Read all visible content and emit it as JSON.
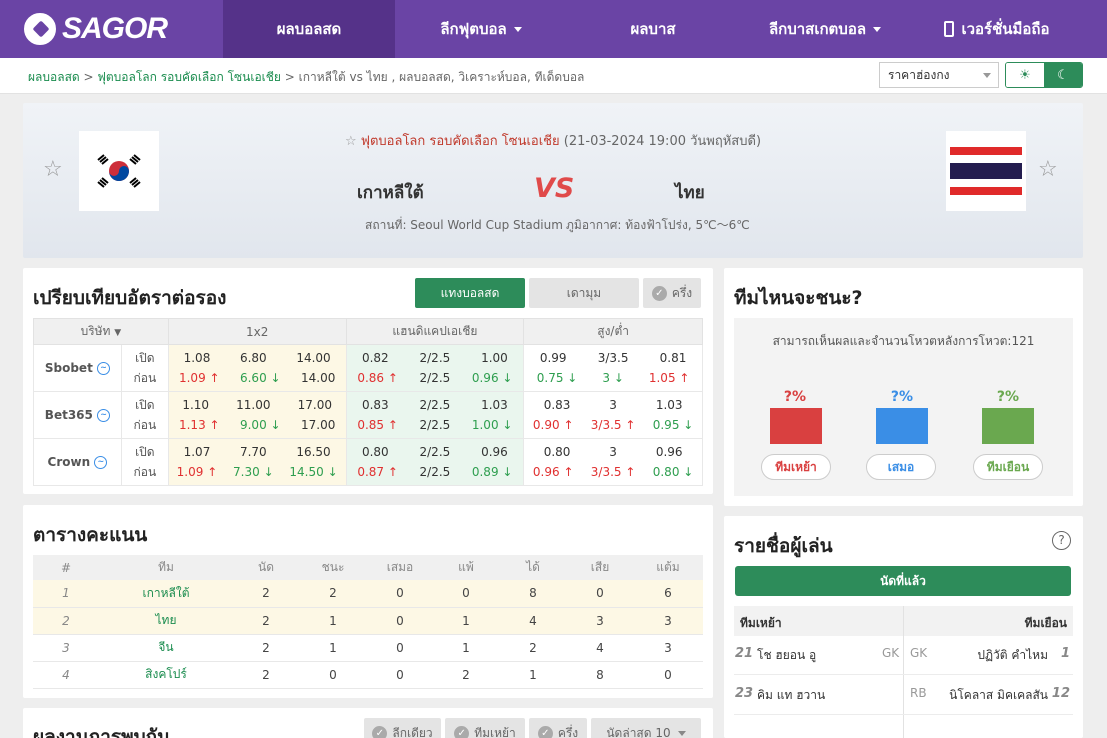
{
  "brand": {
    "name": "SAGOR"
  },
  "nav": [
    {
      "label": "ผลบอลสด",
      "active": true,
      "caret": false,
      "w": 172
    },
    {
      "label": "ลีกฟุตบอล",
      "active": false,
      "caret": true,
      "w": 172
    },
    {
      "label": "ผลบาส",
      "active": false,
      "caret": false,
      "w": 172
    },
    {
      "label": "ลีกบาสเกตบอล",
      "active": false,
      "caret": true,
      "w": 172
    },
    {
      "label": "เวอร์ชั่นมือถือ",
      "active": false,
      "caret": false,
      "w": 172
    }
  ],
  "breadcrumb": {
    "home": "ผลบอลสด",
    "league": "ฟุตบอลโลก รอบคัดเลือก โซนเอเชีย",
    "rest": "เกาหลีใต้ vs  ไทย ,  ผลบอลสด,  วิเคราะห์บอล,  ทีเด็ดบอล"
  },
  "odds_format": "ราคาฮ่องกง",
  "match": {
    "league": "ฟุตบอลโลก รอบคัดเลือก โซนเอเชีย",
    "date": "(21-03-2024 19:00 วันพฤหัสบดี)",
    "home": "เกาหลีใต้",
    "vs": "VS",
    "away": "ไทย",
    "venue": "สถานที่: Seoul World Cup Stadium",
    "weather": "ภูมิอากาศ: ท้องฟ้าโปร่ง, 5℃～6℃"
  },
  "odds_panel": {
    "title": "เปรียบเทียบอัตราต่อรอง",
    "tab_live": "แทงบอลสด",
    "tab_early": "เดามุม",
    "half": "ครึ่ง",
    "h_company": "บริษัท",
    "h_1x2": "1x2",
    "h_hdp": "แฮนดิแคปเอเชีย",
    "h_ou": "สูง/ต่ำ",
    "open": "เปิด",
    "before": "ก่อน",
    "rows": [
      {
        "company": "Sbobet",
        "o1": [
          "1.08",
          "6.80",
          "14.00"
        ],
        "c1": [
          [
            "1.09",
            "up"
          ],
          [
            "6.60",
            "dn"
          ],
          [
            "14.00",
            ""
          ]
        ],
        "o2": [
          "0.82",
          "2/2.5",
          "1.00"
        ],
        "c2": [
          [
            "0.86",
            "up"
          ],
          [
            "2/2.5",
            ""
          ],
          [
            "0.96",
            "dn"
          ]
        ],
        "o3": [
          "0.99",
          "3/3.5",
          "0.81"
        ],
        "c3": [
          [
            "0.75",
            "dn"
          ],
          [
            "3",
            "dn"
          ],
          [
            "1.05",
            "up"
          ]
        ]
      },
      {
        "company": "Bet365",
        "o1": [
          "1.10",
          "11.00",
          "17.00"
        ],
        "c1": [
          [
            "1.13",
            "up"
          ],
          [
            "9.00",
            "dn"
          ],
          [
            "17.00",
            ""
          ]
        ],
        "o2": [
          "0.83",
          "2/2.5",
          "1.03"
        ],
        "c2": [
          [
            "0.85",
            "up"
          ],
          [
            "2/2.5",
            ""
          ],
          [
            "1.00",
            "dn"
          ]
        ],
        "o3": [
          "0.83",
          "3",
          "1.03"
        ],
        "c3": [
          [
            "0.90",
            "up"
          ],
          [
            "3/3.5",
            "up"
          ],
          [
            "0.95",
            "dn"
          ]
        ]
      },
      {
        "company": "Crown",
        "o1": [
          "1.07",
          "7.70",
          "16.50"
        ],
        "c1": [
          [
            "1.09",
            "up"
          ],
          [
            "7.30",
            "dn"
          ],
          [
            "14.50",
            "dn"
          ]
        ],
        "o2": [
          "0.80",
          "2/2.5",
          "0.96"
        ],
        "c2": [
          [
            "0.87",
            "up"
          ],
          [
            "2/2.5",
            ""
          ],
          [
            "0.89",
            "dn"
          ]
        ],
        "o3": [
          "0.80",
          "3",
          "0.96"
        ],
        "c3": [
          [
            "0.96",
            "up"
          ],
          [
            "3/3.5",
            "up"
          ],
          [
            "0.80",
            "dn"
          ]
        ]
      }
    ]
  },
  "vote": {
    "title": "ทีมไหนจะชนะ?",
    "note": "สามารถเห็นผลและจำนวนโหวตหลังการโหวต:121",
    "home_pct": "?%",
    "draw_pct": "?%",
    "away_pct": "?%",
    "home": "ทีมเหย้า",
    "draw": "เสมอ",
    "away": "ทีมเยือน",
    "colors": {
      "home": "#d94040",
      "draw": "#3a8ee6",
      "away": "#6aa84f"
    }
  },
  "standings": {
    "title": "ตารางคะแนน",
    "headers": [
      "#",
      "ทีม",
      "นัด",
      "ชนะ",
      "เสมอ",
      "แพ้",
      "ได้",
      "เสีย",
      "แต้ม"
    ],
    "rows": [
      [
        "1",
        "เกาหลีใต้",
        "2",
        "2",
        "0",
        "0",
        "8",
        "0",
        "6"
      ],
      [
        "2",
        "ไทย",
        "2",
        "1",
        "0",
        "1",
        "4",
        "3",
        "3"
      ],
      [
        "3",
        "จีน",
        "2",
        "1",
        "0",
        "1",
        "2",
        "4",
        "3"
      ],
      [
        "4",
        "สิงคโปร์",
        "2",
        "0",
        "0",
        "2",
        "1",
        "8",
        "0"
      ]
    ]
  },
  "lineup": {
    "title": "รายชื่อผู้เล่น",
    "button": "นัดที่แล้ว",
    "home": "ทีมเหย้า",
    "away": "ทีมเยือน",
    "players": [
      {
        "hn": "21",
        "hname": "โช ฮยอน อู",
        "hpos": "GK",
        "apos": "GK",
        "aname": "ปฏิวัติ คำไหม",
        "an": "1"
      },
      {
        "hn": "23",
        "hname": "คิม แท ฮวาน",
        "hpos": "",
        "apos": "RB",
        "aname": "นิโคลาส มิคเคลสัน",
        "an": "12"
      }
    ]
  },
  "h2h": {
    "title": "ผลงานการพบกัน",
    "f1": "ลีกเดียว",
    "f2": "ทีมเหย้า",
    "f3": "ครึ่ง",
    "f4": "นัดล่าสุด 10"
  }
}
